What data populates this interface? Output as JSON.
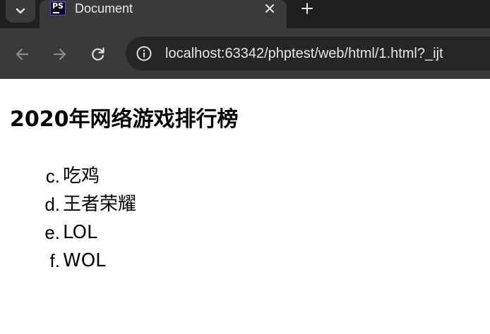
{
  "browser": {
    "tab": {
      "favicon_text": "PS",
      "title": "Document",
      "close_glyph": "✕"
    },
    "new_tab_glyph": "+",
    "address_bar": {
      "url": "localhost:63342/phptest/web/html/1.html?_ijt"
    },
    "icons": [
      "chevron-down-icon",
      "phpstorm-favicon-icon",
      "close-icon",
      "plus-icon",
      "back-arrow-icon",
      "forward-arrow-icon",
      "reload-icon",
      "info-icon"
    ]
  },
  "page": {
    "heading": "2020年网络游戏排行榜",
    "list": {
      "type": "lower-alpha",
      "start": 3,
      "items": [
        {
          "marker": "c.",
          "text": "吃鸡"
        },
        {
          "marker": "d.",
          "text": "王者荣耀"
        },
        {
          "marker": "e.",
          "text": "LOL"
        },
        {
          "marker": "f.",
          "text": "WOL"
        }
      ]
    }
  },
  "colors": {
    "tabstrip_bg": "#1f1f1f",
    "toolbar_bg": "#3a3a3a",
    "omnibox_bg": "#262626",
    "favicon_border": "#6f3fe0",
    "page_bg": "#ffffff"
  }
}
